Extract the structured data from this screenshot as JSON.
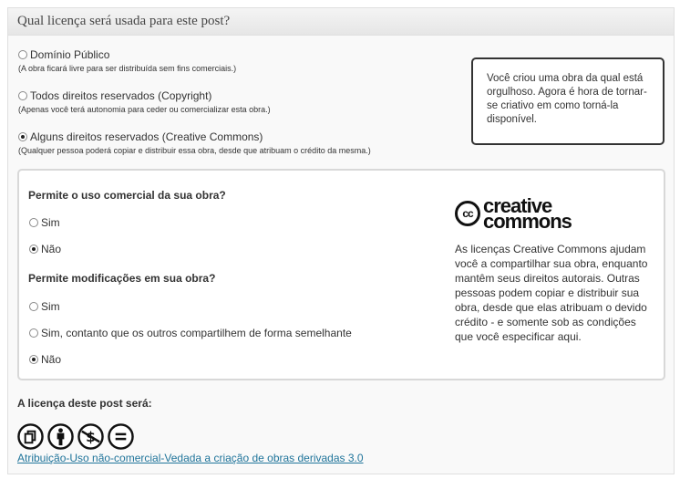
{
  "panel": {
    "title": "Qual licença será usada para este post?"
  },
  "options": [
    {
      "label": "Domínio Público",
      "desc": "(A obra ficará livre para ser distribuída sem fins comerciais.)",
      "selected": false
    },
    {
      "label": "Todos direitos reservados (Copyright)",
      "desc": "(Apenas você terá autonomia para ceder ou comercializar esta obra.)",
      "selected": false
    },
    {
      "label": "Alguns direitos reservados (Creative Commons)",
      "desc": "(Qualquer pessoa poderá copiar e distribuir essa obra, desde que atribuam o crédito da mesma.)",
      "selected": true
    }
  ],
  "tip": {
    "text": "Você criou uma obra da qual está orgulhoso. Agora é hora de tornar-se criativo em como torná-la disponível."
  },
  "cc": {
    "q1": "Permite o uso comercial da sua obra?",
    "q1_options": [
      {
        "label": "Sim",
        "selected": false
      },
      {
        "label": "Não",
        "selected": true
      }
    ],
    "q2": "Permite modificações em sua obra?",
    "q2_options": [
      {
        "label": "Sim",
        "selected": false
      },
      {
        "label": "Sim, contanto que os outros compartilhem de forma semelhante",
        "selected": false
      },
      {
        "label": "Não",
        "selected": true
      }
    ],
    "logo_circle": "cc",
    "logo_line1": "creative",
    "logo_line2": "commons",
    "description": "As licenças Creative Commons ajudam você a compartilhar sua obra, enquanto mantêm seus direitos autorais. Outras pessoas podem copiar e distribuir sua obra, desde que elas atribuam o devido crédito - e somente sob as condições que você especificar aqui."
  },
  "result": {
    "label": "A licença deste post será:",
    "icons": [
      "cc-share-icon",
      "attribution-icon",
      "noncommercial-icon",
      "no-derivatives-icon"
    ],
    "link_text": "Atribuição-Uso não-comercial-Vedada a criação de obras derivadas 3.0"
  },
  "colors": {
    "link": "#21759b",
    "header_bg": "#e9e9e9",
    "tip_border": "#333333"
  }
}
